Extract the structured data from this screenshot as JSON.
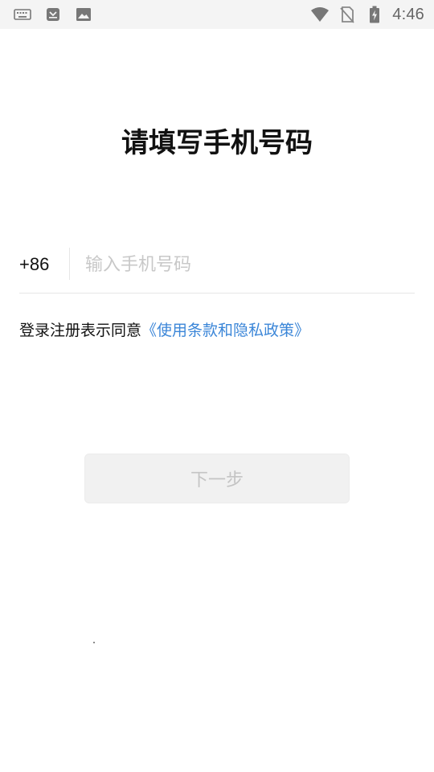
{
  "status_bar": {
    "time": "4:46",
    "icons": [
      "keyboard-icon",
      "app-notification-icon",
      "image-icon",
      "wifi-icon",
      "no-sim-icon",
      "battery-charging-icon"
    ]
  },
  "page": {
    "title": "请填写手机号码"
  },
  "phone_form": {
    "country_code": "+86",
    "phone_value": "",
    "phone_placeholder": "输入手机号码"
  },
  "agreement": {
    "prefix": "登录注册表示同意",
    "link": "《使用条款和隐私政策》"
  },
  "actions": {
    "next_label": "下一步"
  },
  "colors": {
    "link": "#3b86d8",
    "disabled_text": "#c4c4c4",
    "disabled_bg": "#f1f1f1",
    "status_bar_bg": "#f4f4f4"
  }
}
